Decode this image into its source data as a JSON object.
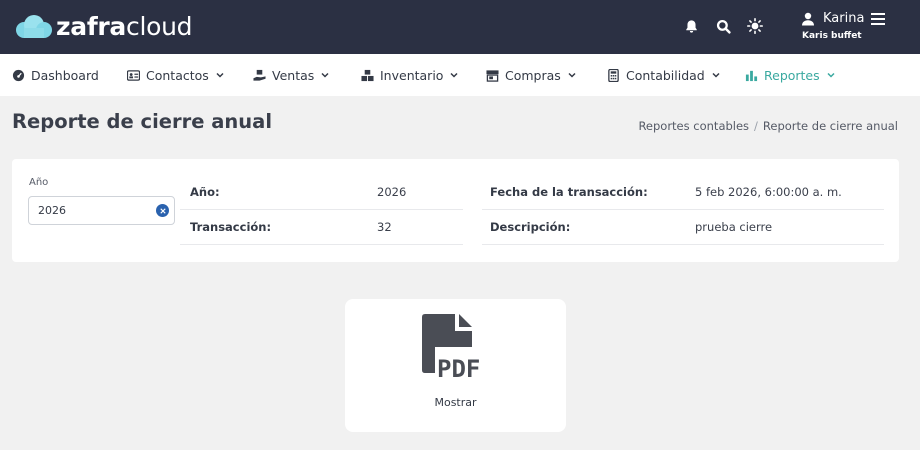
{
  "app": {
    "logo_bold": "zafra",
    "logo_light": "cloud"
  },
  "header": {
    "user_name": "Karina",
    "user_company": "Karis buffet"
  },
  "nav": {
    "items": [
      {
        "label": "Dashboard"
      },
      {
        "label": "Contactos"
      },
      {
        "label": "Ventas"
      },
      {
        "label": "Inventario"
      },
      {
        "label": "Compras"
      },
      {
        "label": "Contabilidad"
      },
      {
        "label": "Reportes"
      }
    ],
    "active_color": "#3aa9a0"
  },
  "page": {
    "title": "Reporte de cierre anual",
    "breadcrumb": [
      "Reportes contables",
      "Reporte de cierre anual"
    ]
  },
  "filter": {
    "label": "Año",
    "value": "2026"
  },
  "details": {
    "year_label": "Año:",
    "year_value": "2026",
    "transaction_label": "Transacción:",
    "transaction_value": "32",
    "date_label": "Fecha de la transacción:",
    "date_value": "5 feb 2026, 6:00:00 a. m.",
    "description_label": "Descripción:",
    "description_value": "prueba cierre"
  },
  "actions": {
    "show_label": "Mostrar",
    "pdf_text": "PDF"
  },
  "colors": {
    "topbar": "#2b3043",
    "logo_cloud": "#7fd6e6",
    "accent": "#3aa9a0",
    "clear_button": "#2a62ae"
  }
}
